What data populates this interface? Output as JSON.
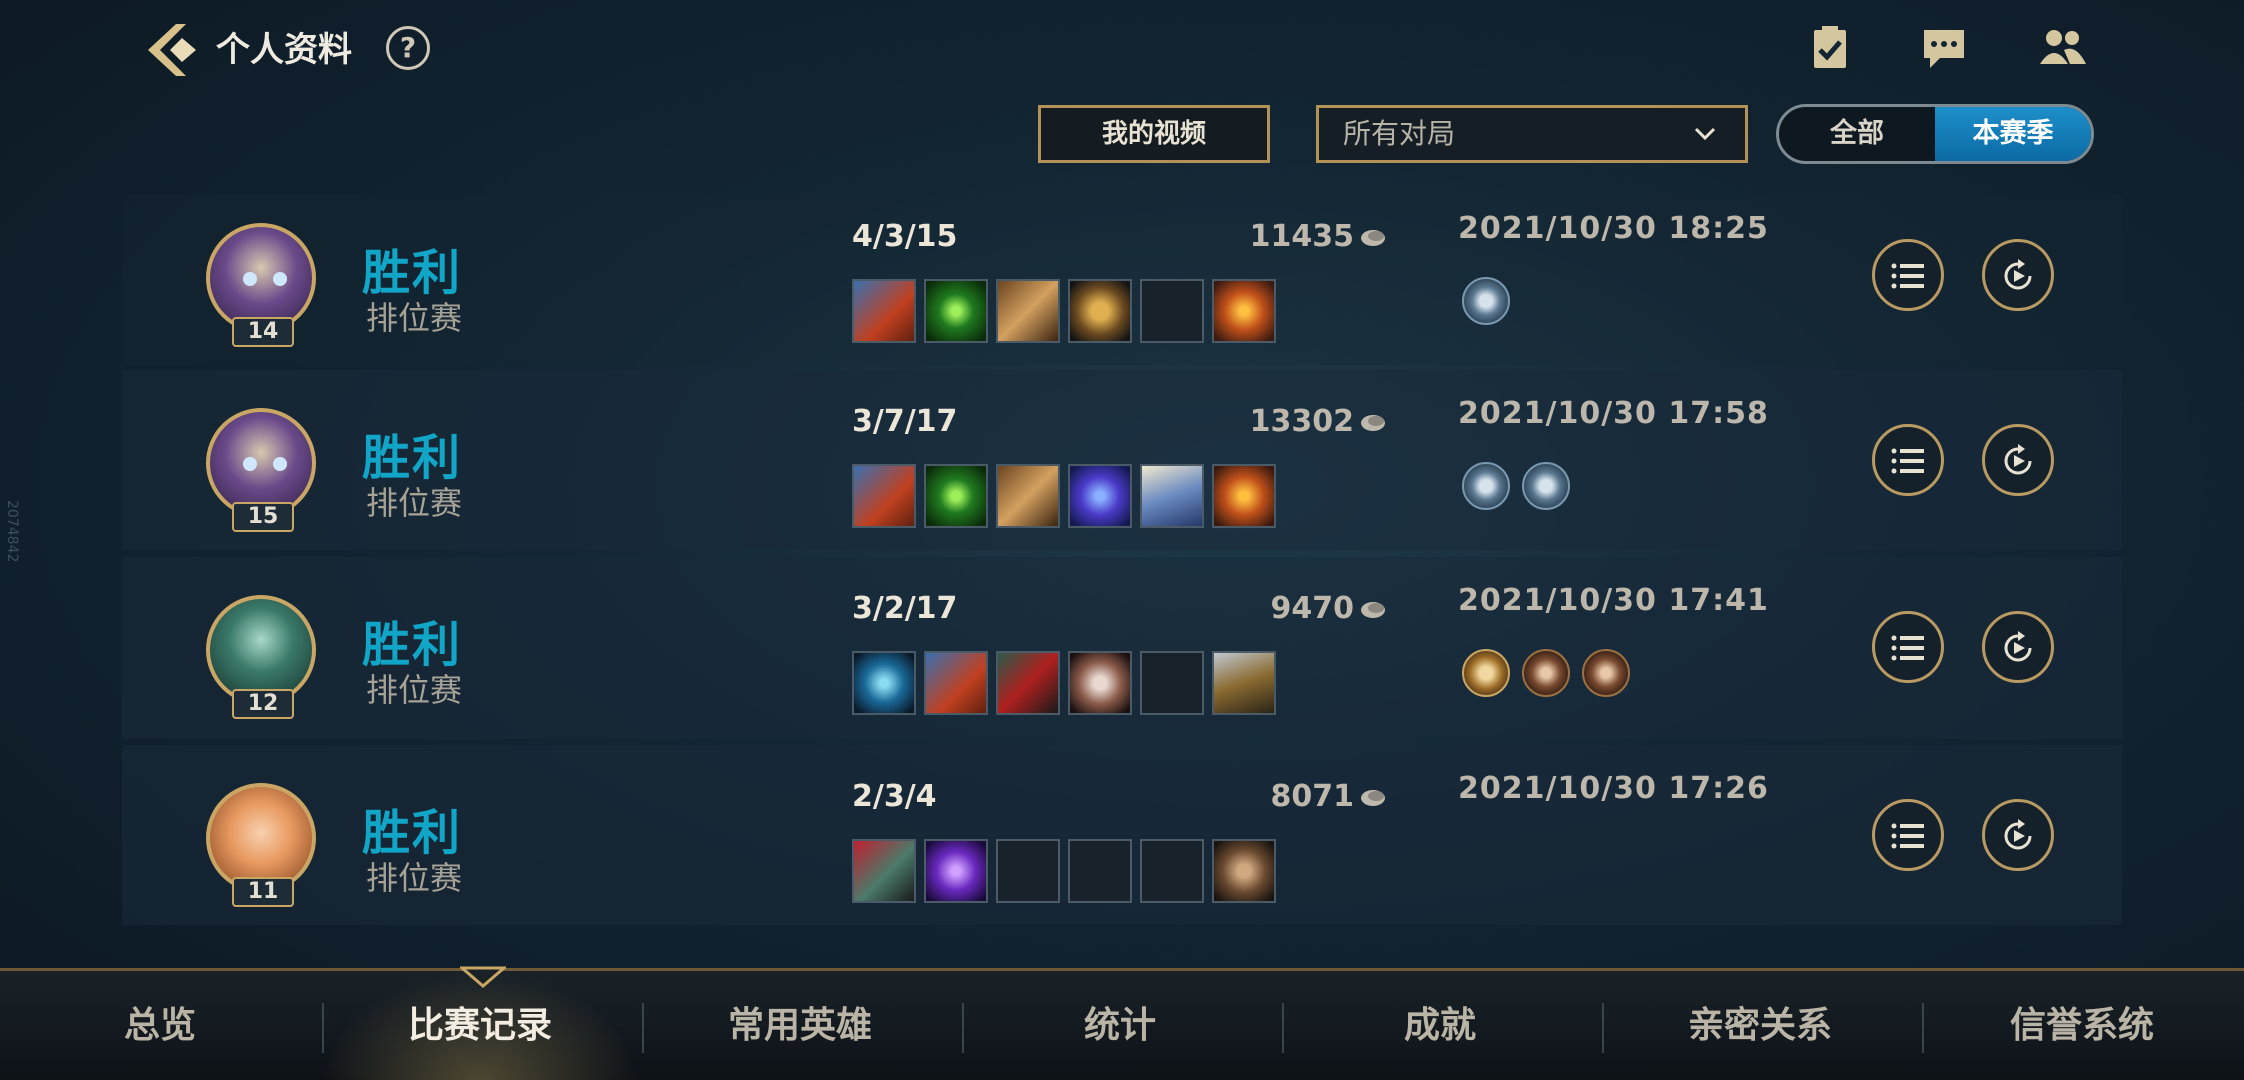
{
  "header": {
    "title": "个人资料",
    "help_label": "?",
    "icons": [
      "task-icon",
      "chat-icon",
      "friends-icon"
    ]
  },
  "filters": {
    "video_button": "我的视频",
    "match_filter": "所有对局",
    "scope_toggle": [
      {
        "label": "全部",
        "active": false
      },
      {
        "label": "本赛季",
        "active": true
      }
    ]
  },
  "matches": [
    {
      "result": "胜利",
      "mode": "排位赛",
      "level": "14",
      "kda": "4/3/15",
      "gold": "11435",
      "datetime": "2021/10/30 18:25",
      "items": [
        "armor-item",
        "green-orb-item",
        "gauntlet-item",
        "gold-armor-item",
        "empty",
        "trinket-item"
      ],
      "badges": [
        "flag-badge"
      ]
    },
    {
      "result": "胜利",
      "mode": "排位赛",
      "level": "15",
      "kda": "3/7/17",
      "gold": "13302",
      "datetime": "2021/10/30 17:58",
      "items": [
        "armor-item",
        "green-orb-item",
        "gauntlet-item",
        "purple-crystal-item",
        "cloak-item",
        "trinket-item"
      ],
      "badges": [
        "flag-badge",
        "shield-badge"
      ]
    },
    {
      "result": "胜利",
      "mode": "排位赛",
      "level": "12",
      "kda": "3/2/17",
      "gold": "9470",
      "datetime": "2021/10/30 17:41",
      "items": [
        "frost-item",
        "armor-item",
        "red-cape-item",
        "stone-item",
        "empty",
        "boots-armor-item"
      ],
      "badges": [
        "s-rank-badge",
        "skull-badge",
        "tower-badge"
      ]
    },
    {
      "result": "胜利",
      "mode": "排位赛",
      "level": "11",
      "kda": "2/3/4",
      "gold": "8071",
      "datetime": "2021/10/30 17:26",
      "items": [
        "red-mask-item",
        "purple-staff-item",
        "empty",
        "empty",
        "empty",
        "boots-item"
      ],
      "badges": []
    }
  ],
  "tabs": [
    {
      "label": "总览",
      "active": false
    },
    {
      "label": "比赛记录",
      "active": true
    },
    {
      "label": "常用英雄",
      "active": false
    },
    {
      "label": "统计",
      "active": false
    },
    {
      "label": "成就",
      "active": false
    },
    {
      "label": "亲密关系",
      "active": false
    },
    {
      "label": "信誉系统",
      "active": false
    }
  ],
  "side_id": "2074842",
  "colors": {
    "win": "#11a6c8",
    "gold_border": "#b29257",
    "toggle_active": "#1d8fca"
  }
}
